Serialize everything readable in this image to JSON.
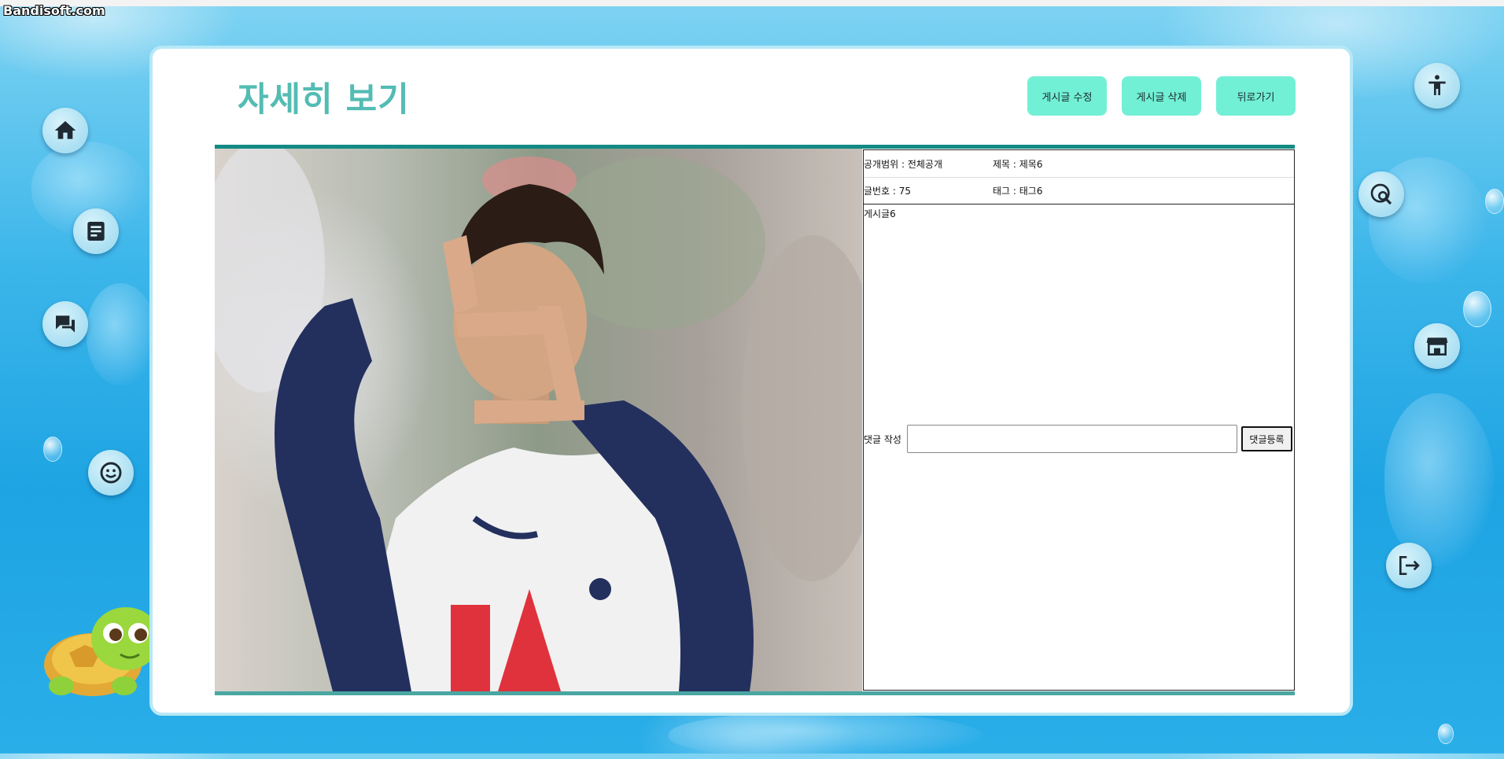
{
  "watermark": "Bandisoft.com",
  "page": {
    "title": "자세히 보기",
    "buttons": {
      "edit": "게시글 수정",
      "delete": "게시글 삭제",
      "back": "뒤로가기"
    }
  },
  "post": {
    "visibility": "공개범위 : 전체공개",
    "title": "제목 : 제목6",
    "number": "글번호 : 75",
    "tag": "태그 : 태그6",
    "content": "게시글6"
  },
  "comment": {
    "label": "댓글 작성",
    "input_value": "",
    "submit_label": "댓글등록"
  },
  "left_nav": [
    "home-icon",
    "document-icon",
    "chat-icon",
    "smile-icon"
  ],
  "right_nav": [
    "accessibility-icon",
    "search-location-icon",
    "store-icon",
    "logout-icon"
  ],
  "colors": {
    "title": "#53bcb3",
    "action_button": "#72f0d6",
    "accent_border": "#138a84",
    "nav_icon": "#1f2a33"
  }
}
